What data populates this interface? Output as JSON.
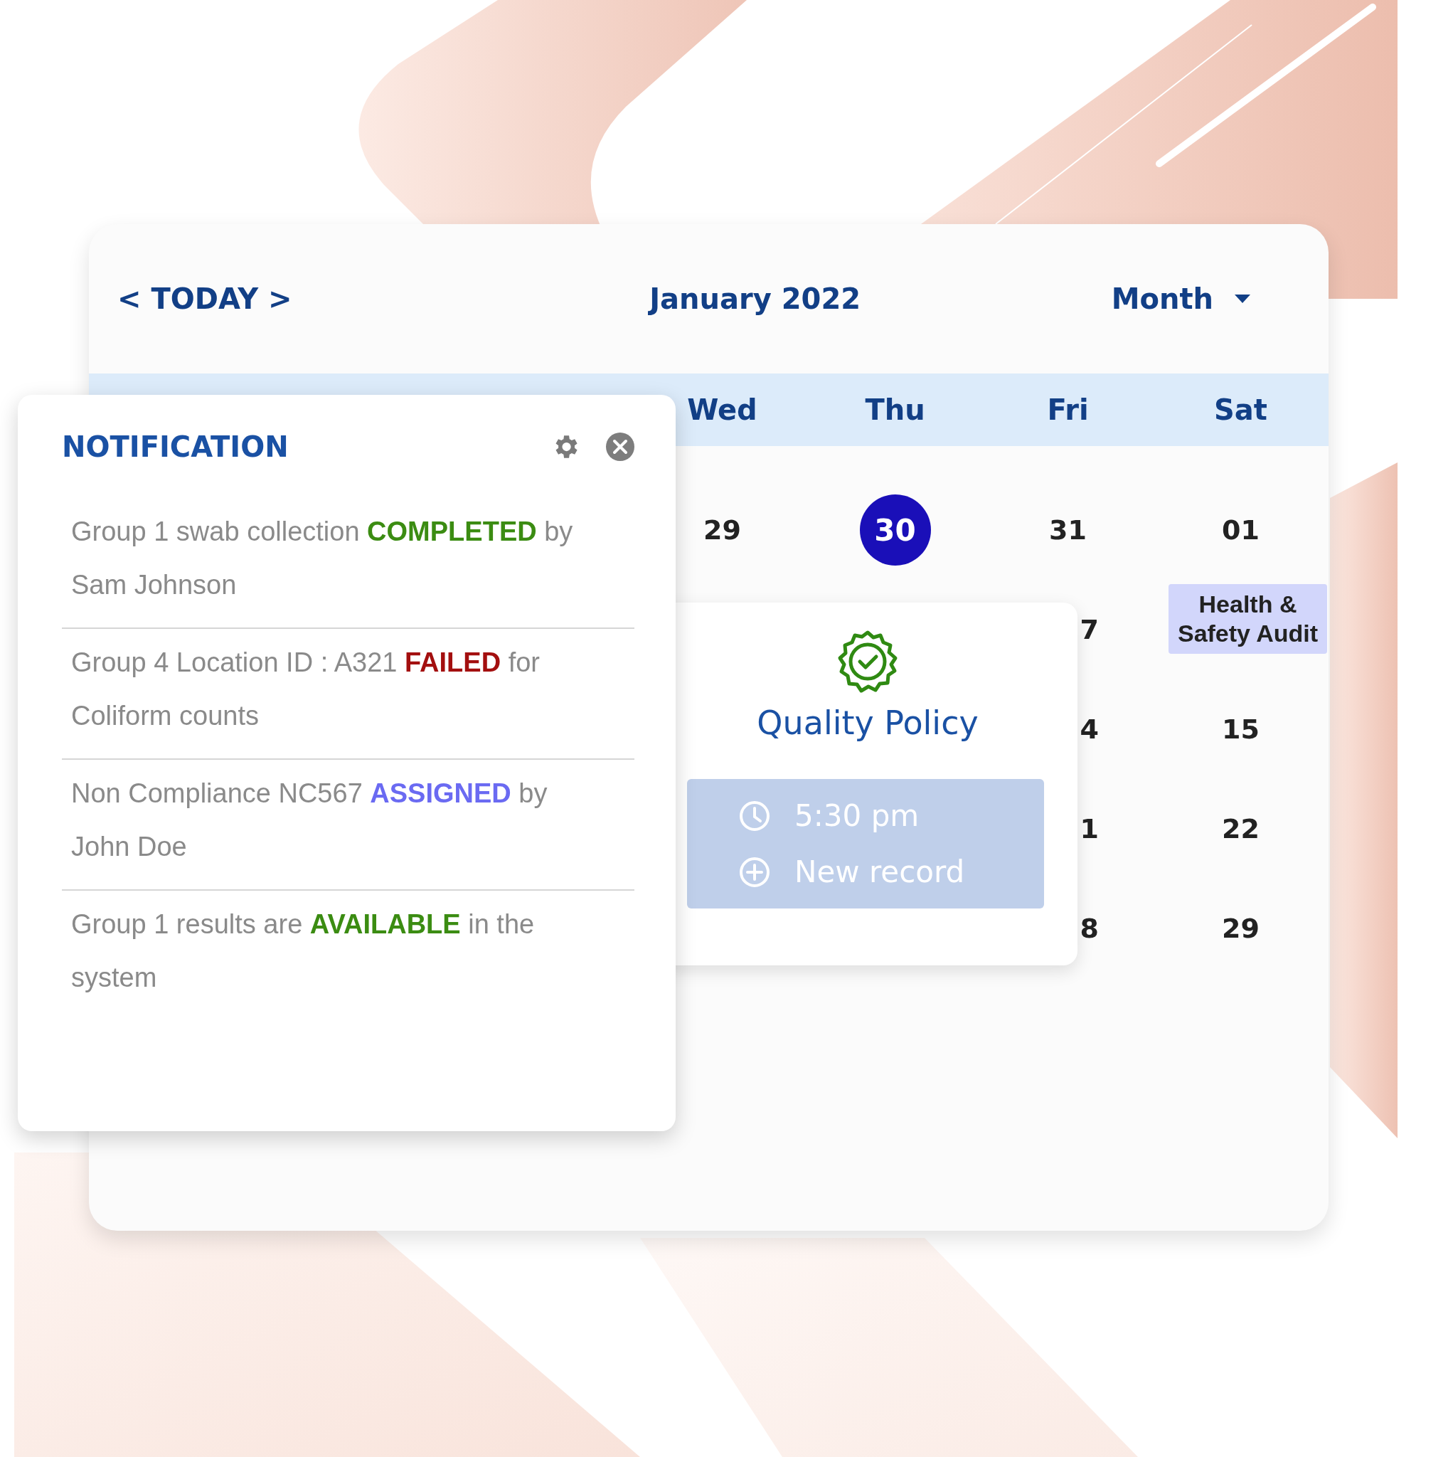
{
  "calendar": {
    "nav": {
      "prev": "<",
      "label": "TODAY",
      "next": ">"
    },
    "title": "January 2022",
    "view": "Month",
    "weekdays": [
      "Wed",
      "Thu",
      "Fri",
      "Sat"
    ],
    "weeks": [
      {
        "days": [
          {
            "label": "29",
            "selected": false
          },
          {
            "label": "30",
            "selected": true
          },
          {
            "label": "31",
            "selected": false
          },
          {
            "label": "01",
            "selected": false
          }
        ]
      },
      {
        "days": [
          {
            "label": "7",
            "selected": false
          },
          {
            "event": "Health & Safety Audit",
            "selected": false
          }
        ]
      },
      {
        "days": [
          {
            "label": "4",
            "selected": false
          },
          {
            "label": "15",
            "selected": false
          }
        ]
      },
      {
        "days": [
          {
            "label": "1",
            "selected": false
          },
          {
            "label": "22",
            "selected": false
          }
        ]
      },
      {
        "days": [
          {
            "label": "8",
            "selected": false
          },
          {
            "label": "29",
            "selected": false
          }
        ]
      }
    ],
    "popup": {
      "title": "Quality Policy",
      "time": "5:30 pm",
      "action": "New record"
    }
  },
  "notification": {
    "title": "NOTIFICATION",
    "items": [
      {
        "before": "Group 1 swab collection",
        "status": "COMPLETED",
        "color": "#3b8c12",
        "after": "by Sam Johnson"
      },
      {
        "before": "Group 4 Location ID : A321",
        "status": "FAILED",
        "color": "#a30f0f",
        "after": "for Coliform counts"
      },
      {
        "before": "Non Compliance NC567 ",
        "status": "ASSIGNED",
        "color": "#6a6af2",
        "after": "by John Doe"
      },
      {
        "before": "Group 1 results are",
        "status": "AVAILABLE",
        "color": "#3b8c12",
        "after": "in the system"
      }
    ]
  }
}
